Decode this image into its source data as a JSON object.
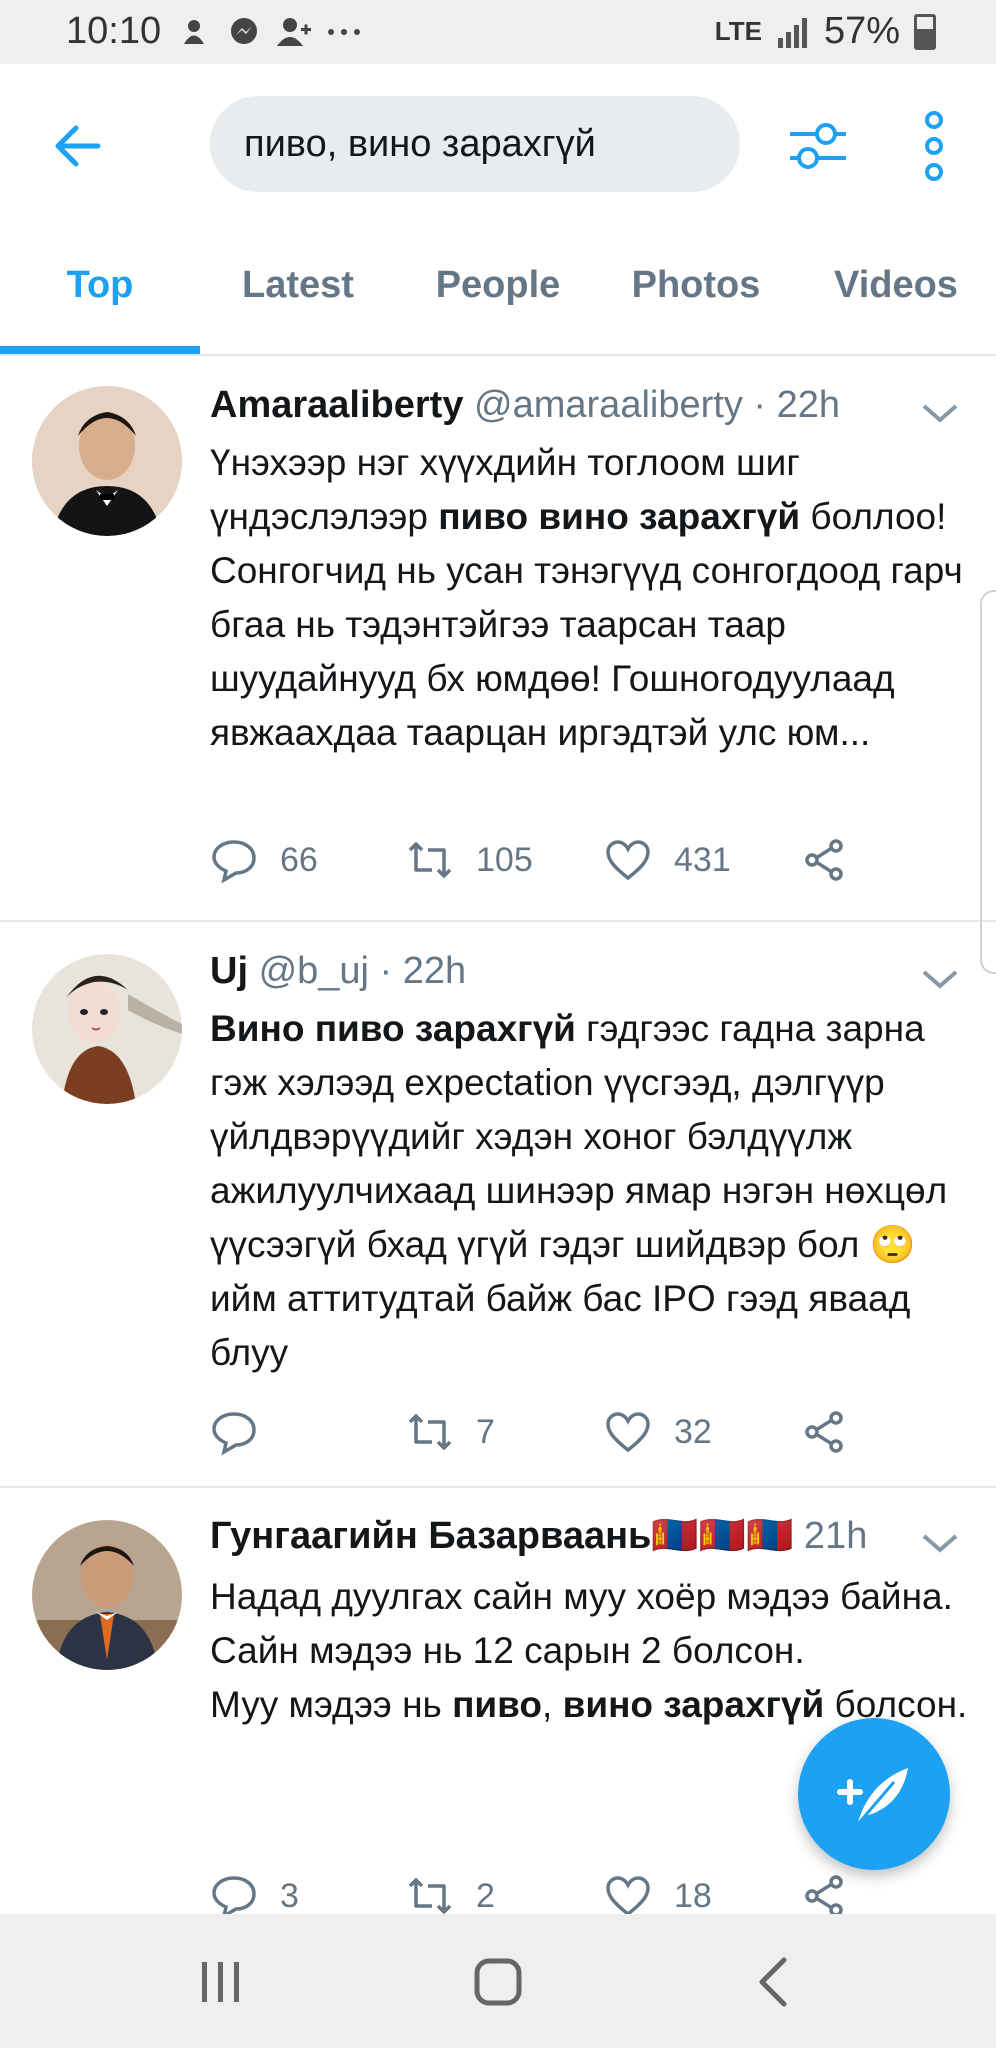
{
  "status_bar": {
    "time": "10:10",
    "network": "LTE",
    "battery": "57%"
  },
  "search": {
    "query": "пиво, вино зарахгүй"
  },
  "tabs": [
    {
      "label": "Top",
      "active": true
    },
    {
      "label": "Latest",
      "active": false
    },
    {
      "label": "People",
      "active": false
    },
    {
      "label": "Photos",
      "active": false
    },
    {
      "label": "Videos",
      "active": false
    }
  ],
  "tweets": [
    {
      "name": "Amaraaliberty",
      "handle": "@amaraaliberty",
      "time": "22h",
      "text_parts": [
        {
          "t": "Үнэхээр нэг хүүхдийн тоглоом шиг үндэслэлээр ",
          "b": false
        },
        {
          "t": "пиво вино зарахгүй",
          "b": true
        },
        {
          "t": " боллоо! Сонгогчид нь усан тэнэгүүд сонгогдоод гарч бгаа нь тэдэнтэйгээ таарсан таар шуудайнууд бх юмдөө! Гошногодуулаад явжаахдаа таарцан иргэдтэй улс юм...",
          "b": false
        }
      ],
      "replies": "66",
      "retweets": "105",
      "likes": "431"
    },
    {
      "name": "Uj",
      "handle": "@b_uj",
      "time": "22h",
      "text_parts": [
        {
          "t": "Вино пиво зарахгүй",
          "b": true
        },
        {
          "t": " гэдгээс гадна зарна гэж хэлээд expectation үүсгээд, дэлгүүр үйлдвэрүүдийг хэдэн хоног бэлдүүлж ажилуулчихаад шинээр ямар нэгэн нөхцөл үүсээгүй бхад үгүй гэдэг шийдвэр бол 🙄 ийм аттитудтай байж бас IPO гээд яваад блуу",
          "b": false
        }
      ],
      "replies": "",
      "retweets": "7",
      "likes": "32"
    },
    {
      "name": "Гунгаагийн Базарваань🇲🇳🇲🇳🇲🇳",
      "handle": "",
      "time": "21h",
      "text_parts": [
        {
          "t": "Надад дуулгах сайн муу хоёр мэдээ байна.\nСайн мэдээ нь 12 сарын 2 болсон.\nМуу мэдээ нь ",
          "b": false
        },
        {
          "t": "пиво",
          "b": true
        },
        {
          "t": ", ",
          "b": false
        },
        {
          "t": "вино зарахгүй",
          "b": true
        },
        {
          "t": " болсон.",
          "b": false
        }
      ],
      "replies": "3",
      "retweets": "2",
      "likes": "18"
    }
  ],
  "colors": {
    "accent": "#1da1f2",
    "muted": "#657786",
    "divider": "#e1e8ed"
  },
  "icons": {
    "back": "arrow-left-icon",
    "filter": "sliders-icon",
    "more": "vertical-dots-icon",
    "compose": "feather-plus-icon"
  }
}
